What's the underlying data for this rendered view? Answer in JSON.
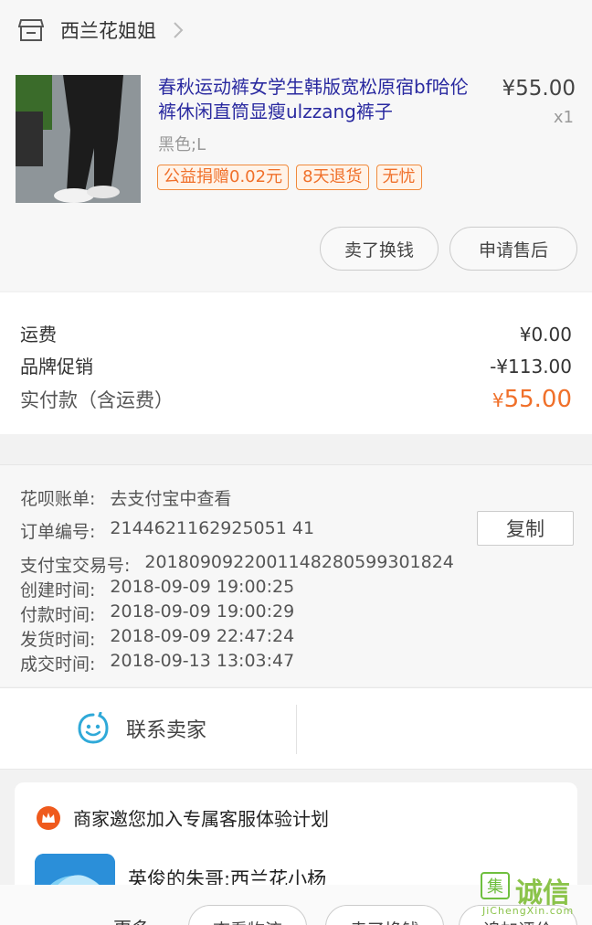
{
  "shop": {
    "name": "西兰花姐姐",
    "icon": "store-icon"
  },
  "product": {
    "title": "春秋运动裤女学生韩版宽松原宿bf哈伦裤休闲直筒显瘦ulzzang裤子",
    "price": "¥55.00",
    "qty": "x1",
    "sku": "黑色;L",
    "tags": [
      "公益捐赠0.02元",
      "8天退货",
      "无忧"
    ],
    "actions": [
      "卖了换钱",
      "申请售后"
    ]
  },
  "fees": {
    "shipping_label": "运费",
    "shipping_value": "¥0.00",
    "promo_label": "品牌促销",
    "promo_value": "-¥113.00",
    "total_label": "实付款（含运费）",
    "total_currency": "¥",
    "total_value": "55.00"
  },
  "info": {
    "huabei_label": "花呗账单:",
    "huabei_value": "去支付宝中查看",
    "order_label": "订单编号:",
    "order_value": "2144621162925051 41",
    "alipay_label": "支付宝交易号:",
    "alipay_value": "2018090922001148280599301824",
    "created_label": "创建时间:",
    "created_value": "2018-09-09 19:00:25",
    "paid_label": "付款时间:",
    "paid_value": "2018-09-09 19:00:29",
    "shipped_label": "发货时间:",
    "shipped_value": "2018-09-09 22:47:24",
    "closed_label": "成交时间:",
    "closed_value": "2018-09-13 13:03:47",
    "copy_label": "复制"
  },
  "contact": {
    "label": "联系卖家",
    "icon": "chat-smile-icon"
  },
  "invite": {
    "title": "商家邀您加入专属客服体验计划",
    "name": "英俊的朱哥:西兰花小杨"
  },
  "bottom": {
    "more": "更多",
    "btn1": "查看物流",
    "btn2": "卖了换钱",
    "btn3": "追加评价"
  },
  "watermark": {
    "logo": "集",
    "text": "诚信",
    "url": "JiChengXin.com"
  },
  "colors": {
    "accent": "#f0702a",
    "link": "#2a2aa0",
    "contact_icon": "#2fa9d8"
  }
}
